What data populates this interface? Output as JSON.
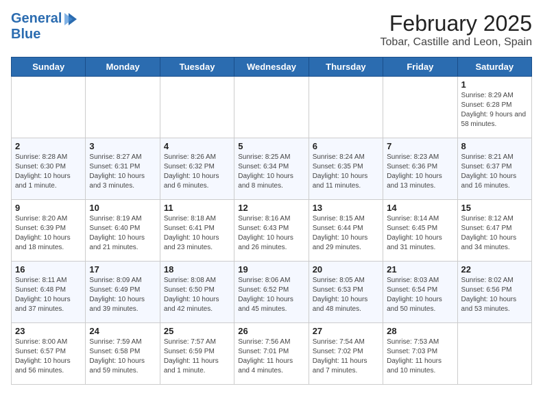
{
  "logo": {
    "line1": "General",
    "line2": "Blue"
  },
  "title": "February 2025",
  "subtitle": "Tobar, Castille and Leon, Spain",
  "days_of_week": [
    "Sunday",
    "Monday",
    "Tuesday",
    "Wednesday",
    "Thursday",
    "Friday",
    "Saturday"
  ],
  "weeks": [
    [
      {
        "day": "",
        "info": ""
      },
      {
        "day": "",
        "info": ""
      },
      {
        "day": "",
        "info": ""
      },
      {
        "day": "",
        "info": ""
      },
      {
        "day": "",
        "info": ""
      },
      {
        "day": "",
        "info": ""
      },
      {
        "day": "1",
        "info": "Sunrise: 8:29 AM\nSunset: 6:28 PM\nDaylight: 9 hours and 58 minutes."
      }
    ],
    [
      {
        "day": "2",
        "info": "Sunrise: 8:28 AM\nSunset: 6:30 PM\nDaylight: 10 hours and 1 minute."
      },
      {
        "day": "3",
        "info": "Sunrise: 8:27 AM\nSunset: 6:31 PM\nDaylight: 10 hours and 3 minutes."
      },
      {
        "day": "4",
        "info": "Sunrise: 8:26 AM\nSunset: 6:32 PM\nDaylight: 10 hours and 6 minutes."
      },
      {
        "day": "5",
        "info": "Sunrise: 8:25 AM\nSunset: 6:34 PM\nDaylight: 10 hours and 8 minutes."
      },
      {
        "day": "6",
        "info": "Sunrise: 8:24 AM\nSunset: 6:35 PM\nDaylight: 10 hours and 11 minutes."
      },
      {
        "day": "7",
        "info": "Sunrise: 8:23 AM\nSunset: 6:36 PM\nDaylight: 10 hours and 13 minutes."
      },
      {
        "day": "8",
        "info": "Sunrise: 8:21 AM\nSunset: 6:37 PM\nDaylight: 10 hours and 16 minutes."
      }
    ],
    [
      {
        "day": "9",
        "info": "Sunrise: 8:20 AM\nSunset: 6:39 PM\nDaylight: 10 hours and 18 minutes."
      },
      {
        "day": "10",
        "info": "Sunrise: 8:19 AM\nSunset: 6:40 PM\nDaylight: 10 hours and 21 minutes."
      },
      {
        "day": "11",
        "info": "Sunrise: 8:18 AM\nSunset: 6:41 PM\nDaylight: 10 hours and 23 minutes."
      },
      {
        "day": "12",
        "info": "Sunrise: 8:16 AM\nSunset: 6:43 PM\nDaylight: 10 hours and 26 minutes."
      },
      {
        "day": "13",
        "info": "Sunrise: 8:15 AM\nSunset: 6:44 PM\nDaylight: 10 hours and 29 minutes."
      },
      {
        "day": "14",
        "info": "Sunrise: 8:14 AM\nSunset: 6:45 PM\nDaylight: 10 hours and 31 minutes."
      },
      {
        "day": "15",
        "info": "Sunrise: 8:12 AM\nSunset: 6:47 PM\nDaylight: 10 hours and 34 minutes."
      }
    ],
    [
      {
        "day": "16",
        "info": "Sunrise: 8:11 AM\nSunset: 6:48 PM\nDaylight: 10 hours and 37 minutes."
      },
      {
        "day": "17",
        "info": "Sunrise: 8:09 AM\nSunset: 6:49 PM\nDaylight: 10 hours and 39 minutes."
      },
      {
        "day": "18",
        "info": "Sunrise: 8:08 AM\nSunset: 6:50 PM\nDaylight: 10 hours and 42 minutes."
      },
      {
        "day": "19",
        "info": "Sunrise: 8:06 AM\nSunset: 6:52 PM\nDaylight: 10 hours and 45 minutes."
      },
      {
        "day": "20",
        "info": "Sunrise: 8:05 AM\nSunset: 6:53 PM\nDaylight: 10 hours and 48 minutes."
      },
      {
        "day": "21",
        "info": "Sunrise: 8:03 AM\nSunset: 6:54 PM\nDaylight: 10 hours and 50 minutes."
      },
      {
        "day": "22",
        "info": "Sunrise: 8:02 AM\nSunset: 6:56 PM\nDaylight: 10 hours and 53 minutes."
      }
    ],
    [
      {
        "day": "23",
        "info": "Sunrise: 8:00 AM\nSunset: 6:57 PM\nDaylight: 10 hours and 56 minutes."
      },
      {
        "day": "24",
        "info": "Sunrise: 7:59 AM\nSunset: 6:58 PM\nDaylight: 10 hours and 59 minutes."
      },
      {
        "day": "25",
        "info": "Sunrise: 7:57 AM\nSunset: 6:59 PM\nDaylight: 11 hours and 1 minute."
      },
      {
        "day": "26",
        "info": "Sunrise: 7:56 AM\nSunset: 7:01 PM\nDaylight: 11 hours and 4 minutes."
      },
      {
        "day": "27",
        "info": "Sunrise: 7:54 AM\nSunset: 7:02 PM\nDaylight: 11 hours and 7 minutes."
      },
      {
        "day": "28",
        "info": "Sunrise: 7:53 AM\nSunset: 7:03 PM\nDaylight: 11 hours and 10 minutes."
      },
      {
        "day": "",
        "info": ""
      }
    ]
  ]
}
